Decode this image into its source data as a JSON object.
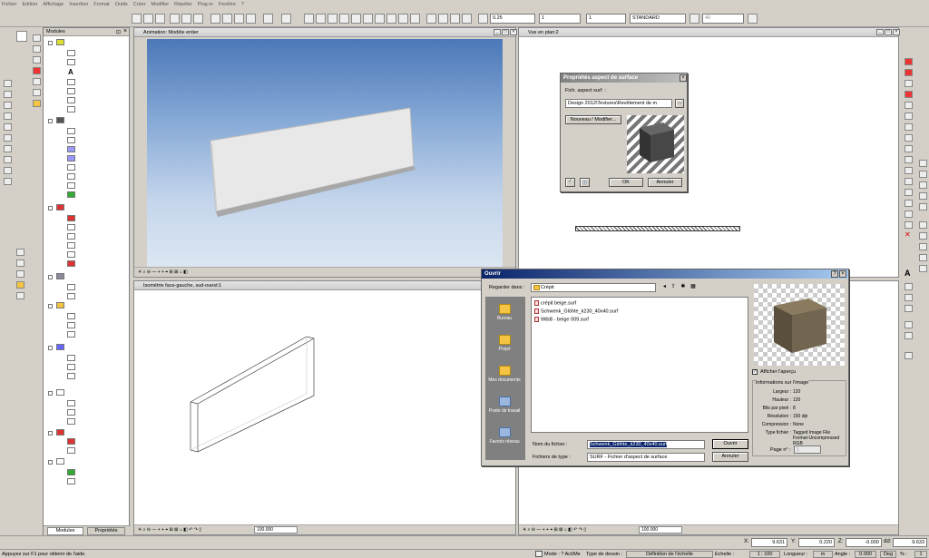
{
  "menu": [
    "Fichier",
    "Edition",
    "Affichage",
    "Insertion",
    "Format",
    "Outils",
    "Créer",
    "Modifier",
    "Répéter",
    "Plug-in",
    "Fenêtre",
    "?"
  ],
  "toolbar": {
    "line_weight": "0.25",
    "line_type": "1",
    "pen": "1",
    "style": "STANDARD",
    "zoom": "40"
  },
  "modules_panel": {
    "title": "Modules",
    "tab_modules": "Modules",
    "tab_properties": "Propriétés"
  },
  "windows": {
    "animation": "Animation: Modèle entier",
    "plan": "Vue en plan:2",
    "iso": "Isométrie face-gauche, sud-ouest:1",
    "zoom_value": "100.000"
  },
  "surface_dialog": {
    "title": "Propriétés aspect de surface",
    "label": "Fich. aspect surf. :",
    "path": "Design 2012\\Textures\\Revêtement de m",
    "new_modify": "Nouveau / Modifier...",
    "ok": "OK",
    "cancel": "Annuler"
  },
  "open_dialog": {
    "title": "Ouvrir",
    "look_in_label": "Regarder dans :",
    "look_in_value": "Crépit",
    "places": [
      "Bureau",
      "Projet",
      "Mes documents",
      "Poste de travail",
      "Favoris réseau"
    ],
    "files": [
      "crépit beige.surf",
      "Schwenk_Glöhte_k230_40x40.surf",
      "WibB - beige 009.surf"
    ],
    "filename_label": "Nom du fichier :",
    "filename_value": "Schwenk_Glöhte_k230_40x40.surf",
    "filetype_label": "Fichiers de type :",
    "filetype_value": "SURF - Fichier d'aspect de surface",
    "open_btn": "Ouvrir",
    "cancel_btn": "Annuler",
    "preview_checkbox": "Afficher l'aperçu",
    "info_title": "Informations sur l'image",
    "info": [
      {
        "k": "Largeur :",
        "v": "120"
      },
      {
        "k": "Hauteur :",
        "v": "120"
      },
      {
        "k": "Bits par pixel :",
        "v": "8"
      },
      {
        "k": "Résolution :",
        "v": "150 dpi"
      },
      {
        "k": "Compression :",
        "v": "None"
      },
      {
        "k": "Type fichier :",
        "v": "Tagged Image File Format-Uncompressed RGB"
      }
    ],
    "page_label": "Page n° :",
    "page_value": "1"
  },
  "coords": {
    "x_label": "X:",
    "x": "9.631",
    "y_label": "Y:",
    "y": "0.220",
    "z_label": "Z:",
    "z": "-0.000",
    "d_label": "dd:",
    "d": "9.633"
  },
  "status": {
    "hint": "Appuyez sur F1 pour obtenir de l'aide.",
    "mode": "Mode : ? Act/Me",
    "drawing_type": "Type de dessin :",
    "scale_def": "Définition de l'échelle",
    "scale_label": "Echelle :",
    "scale": "1 : 100",
    "length_label": "Longueur :",
    "length_unit": "m",
    "angle_label": "Angle :",
    "angle": "0.000",
    "deg": "Deg",
    "pct_label": "% :",
    "pct": "1"
  }
}
